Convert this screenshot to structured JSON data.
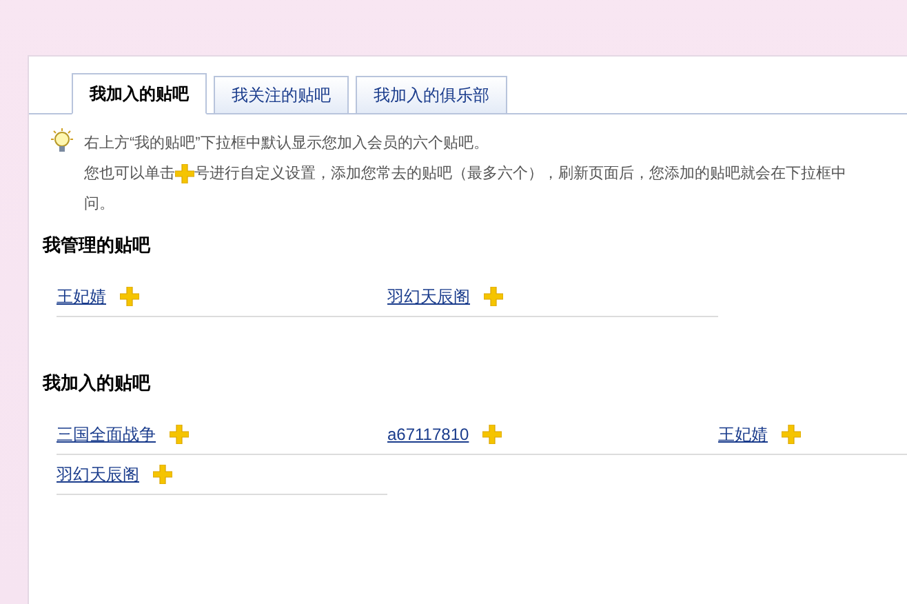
{
  "tabs": [
    {
      "label": "我加入的贴吧",
      "selected": true
    },
    {
      "label": "我关注的贴吧",
      "selected": false
    },
    {
      "label": "我加入的俱乐部",
      "selected": false
    }
  ],
  "tip": {
    "line1": "右上方“我的贴吧”下拉框中默认显示您加入会员的六个贴吧。",
    "line2_before": "您也可以单击",
    "line2_after": "号进行自定义设置，添加您常去的贴吧（最多六个），刷新页面后，您添加的贴吧就会在下拉框中",
    "line3": "问。"
  },
  "sections": [
    {
      "title": "我管理的贴吧",
      "kind": "narrow",
      "items": [
        {
          "name": "王妃婧"
        },
        {
          "name": "羽幻天辰阁"
        }
      ]
    },
    {
      "title": "我加入的贴吧",
      "kind": "wide",
      "items": [
        {
          "name": "三国全面战争"
        },
        {
          "name": "a67117810"
        },
        {
          "name": "王妃婧"
        },
        {
          "name": "羽幻天辰阁"
        }
      ]
    }
  ]
}
